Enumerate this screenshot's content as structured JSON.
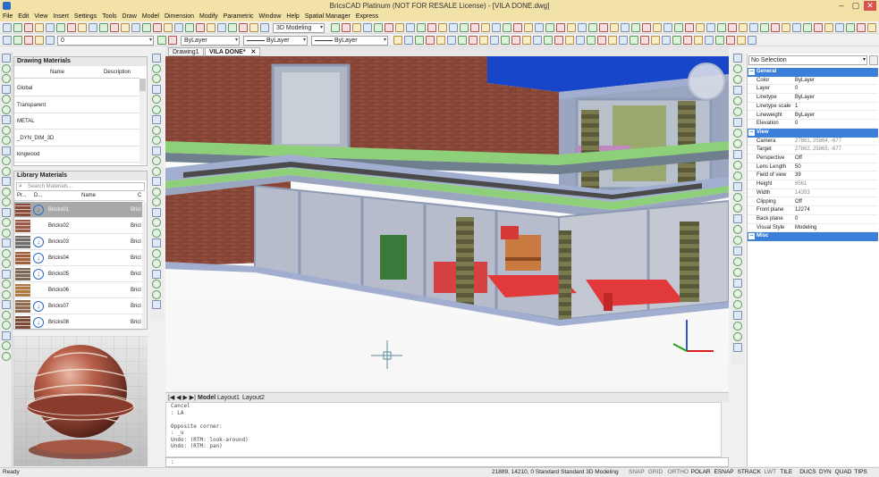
{
  "window": {
    "title": "BricsCAD Platinum (NOT FOR RESALE License) - [VILA DONE.dwg]"
  },
  "menu": [
    "File",
    "Edit",
    "View",
    "Insert",
    "Settings",
    "Tools",
    "Draw",
    "Model",
    "Dimension",
    "Modify",
    "Parametric",
    "Window",
    "Help",
    "Spatial Manager",
    "Express"
  ],
  "toolbar": {
    "workspace": "3D Modeling",
    "layer_value": "0",
    "color_value": "ByLayer",
    "linetype_value": "ByLayer",
    "lineweight_value": "ByLayer"
  },
  "doc_tabs": [
    "Drawing1",
    "VILA DONE*"
  ],
  "drawing_materials": {
    "title": "Drawing Materials",
    "columns": [
      "Name",
      "Description"
    ],
    "items": [
      "Global",
      "Transparent",
      "METAL",
      "_DYN_DIM_3D",
      "kingwood"
    ]
  },
  "library_materials": {
    "title": "Library Materials",
    "search_placeholder": "Search Materials...",
    "columns": [
      "Pr...",
      "D...",
      "Name",
      "C"
    ],
    "items": [
      {
        "name": "Bricks01",
        "cat": "Bricl",
        "download": true,
        "selected": true,
        "swatch": "#8a4a3c"
      },
      {
        "name": "Bricks02",
        "cat": "Bricl",
        "download": false,
        "selected": false,
        "swatch": "#9b5a48"
      },
      {
        "name": "Bricks03",
        "cat": "Bricl",
        "download": true,
        "selected": false,
        "swatch": "#6e6e6e"
      },
      {
        "name": "Bricks04",
        "cat": "Bricl",
        "download": true,
        "selected": false,
        "swatch": "#a0603e"
      },
      {
        "name": "Bricks05",
        "cat": "Bricl",
        "download": true,
        "selected": false,
        "swatch": "#7a6a5a"
      },
      {
        "name": "Bricks06",
        "cat": "Bricl",
        "download": false,
        "selected": false,
        "swatch": "#b07a40"
      },
      {
        "name": "Bricks07",
        "cat": "Bricl",
        "download": true,
        "selected": false,
        "swatch": "#8e6a52"
      },
      {
        "name": "Bricks08",
        "cat": "Bricl",
        "download": true,
        "selected": false,
        "swatch": "#7a4a3a"
      }
    ]
  },
  "layout_tabs": [
    "Model",
    "Layout1",
    "Layout2"
  ],
  "command_history": [
    "Cancel",
    ": LA",
    "",
    "Opposite corner:",
    ": _u",
    "Undo: (RTM: look-around)",
    "Undo: (RTM: pan)"
  ],
  "command_prompt": ":",
  "properties": {
    "selection": "No Selection",
    "sections": [
      {
        "name": "General",
        "rows": [
          {
            "k": "Color",
            "v": "ByLayer"
          },
          {
            "k": "Layer",
            "v": "0"
          },
          {
            "k": "Linetype",
            "v": "ByLayer"
          },
          {
            "k": "Linetype scale",
            "v": "1"
          },
          {
            "k": "Lineweight",
            "v": "ByLayer"
          },
          {
            "k": "Elevation",
            "v": "0"
          }
        ]
      },
      {
        "name": "View",
        "rows": [
          {
            "k": "Camera",
            "v": "27861, 25864, -677",
            "ro": true
          },
          {
            "k": "Target",
            "v": "27862, 25865, -677",
            "ro": true
          },
          {
            "k": "Perspective",
            "v": "Off"
          },
          {
            "k": "Lens Length",
            "v": "50"
          },
          {
            "k": "Field of view",
            "v": "39"
          },
          {
            "k": "Height",
            "v": "8561",
            "ro": true
          },
          {
            "k": "Width",
            "v": "14393",
            "ro": true
          },
          {
            "k": "Clipping",
            "v": "Off"
          },
          {
            "k": "Front plane",
            "v": "12274"
          },
          {
            "k": "Back plane",
            "v": "0"
          },
          {
            "k": "Visual Style",
            "v": "Modeling"
          }
        ]
      },
      {
        "name": "Misc",
        "rows": []
      }
    ]
  },
  "status": {
    "ready": "Ready",
    "coords": "21889, 14210, 0  Standard  Standard  3D Modeling",
    "toggles": [
      {
        "label": "SNAP",
        "on": false
      },
      {
        "label": "GRID",
        "on": false
      },
      {
        "label": "ORTHO",
        "on": false
      },
      {
        "label": "POLAR",
        "on": true
      },
      {
        "label": "ESNAP",
        "on": true
      },
      {
        "label": "STRACK",
        "on": true
      },
      {
        "label": "LWT",
        "on": false
      },
      {
        "label": "TILE",
        "on": true
      },
      {
        "label": "DUCS",
        "on": true
      },
      {
        "label": "DYN",
        "on": true
      },
      {
        "label": "QUAD",
        "on": true
      },
      {
        "label": "TIPS",
        "on": true
      }
    ]
  },
  "colors": {
    "accent": "#3c7fd8",
    "titlebar": "#f3e2a8",
    "brick": "#8a4a3c",
    "glass": "#9aa6c0",
    "frame": "#a2aed0",
    "slab_green": "#8ed07a",
    "roof_blue": "#1846c8"
  }
}
